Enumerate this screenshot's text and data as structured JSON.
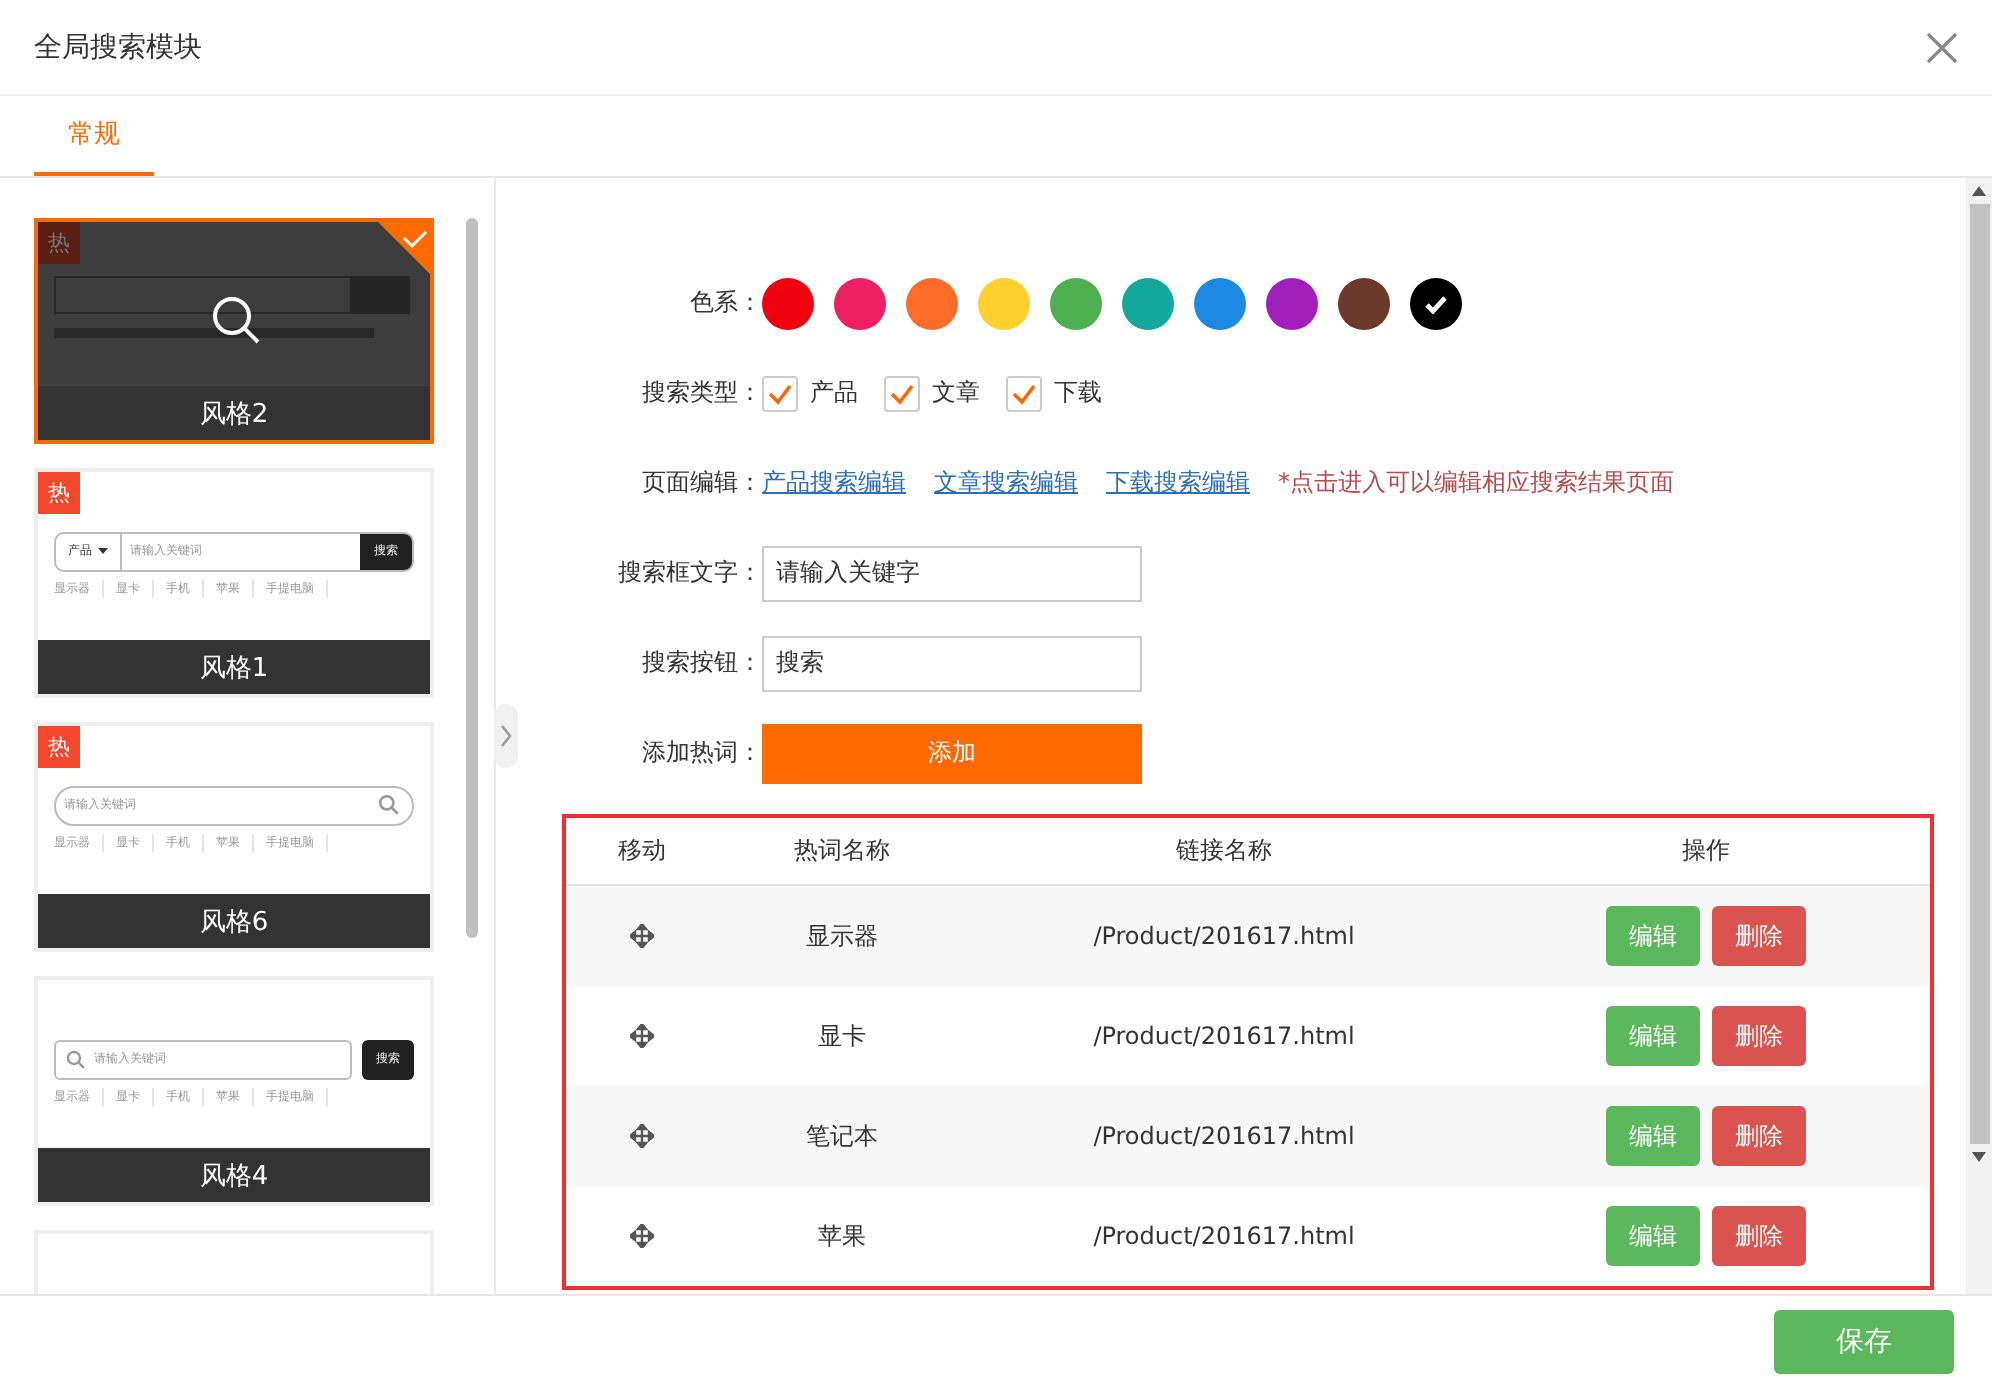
{
  "dialog": {
    "title": "全局搜索模块"
  },
  "tabs": [
    {
      "label": "常规",
      "selected": true
    }
  ],
  "styles": [
    {
      "name": "风格2",
      "kind": "icon-dropdown",
      "selected": true,
      "badge": "热"
    },
    {
      "name": "风格1",
      "kind": "dropdown-left",
      "selected": false,
      "badge": "热",
      "placeholder": "请输入关键词",
      "dropdown": "产品",
      "button": "搜索",
      "hotwords": [
        "显示器",
        "显卡",
        "手机",
        "苹果",
        "手提电脑"
      ]
    },
    {
      "name": "风格6",
      "kind": "rounded",
      "selected": false,
      "badge": "热",
      "placeholder": "请输入关键词",
      "hotwords": [
        "显示器",
        "显卡",
        "手机",
        "苹果",
        "手提电脑"
      ]
    },
    {
      "name": "风格4",
      "kind": "button-apart",
      "selected": false,
      "placeholder": "请输入关键词",
      "button": "搜索",
      "hotwords": [
        "显示器",
        "显卡",
        "手机",
        "苹果",
        "手提电脑"
      ]
    }
  ],
  "form": {
    "color_label": "色系：",
    "colors": [
      {
        "color": "#f0000f",
        "selected": false
      },
      {
        "color": "#ef1f64",
        "selected": false
      },
      {
        "color": "#ff6d28",
        "selected": false
      },
      {
        "color": "#ffd02e",
        "selected": false
      },
      {
        "color": "#4caf50",
        "selected": false
      },
      {
        "color": "#12a99a",
        "selected": false
      },
      {
        "color": "#1e88e5",
        "selected": false
      },
      {
        "color": "#a11fbb",
        "selected": false
      },
      {
        "color": "#6b3a28",
        "selected": false
      },
      {
        "color": "#000000",
        "selected": true
      }
    ],
    "type_label": "搜索类型：",
    "types": [
      {
        "label": "产品",
        "checked": true
      },
      {
        "label": "文章",
        "checked": true
      },
      {
        "label": "下载",
        "checked": true
      }
    ],
    "page_label": "页面编辑：",
    "page_links": [
      "产品搜索编辑",
      "文章搜索编辑",
      "下载搜索编辑"
    ],
    "page_note": "*点击进入可以编辑相应搜索结果页面",
    "text_label": "搜索框文字：",
    "text_value": "请输入关键字",
    "button_label": "搜索按钮：",
    "button_value": "搜索",
    "hot_label": "添加热词：",
    "add_button": "添加"
  },
  "table": {
    "columns": [
      "移动",
      "热词名称",
      "链接名称",
      "操作"
    ],
    "rows": [
      {
        "name": "显示器",
        "link": "/Product/201617.html",
        "edit": "编辑",
        "delete": "删除"
      },
      {
        "name": "显卡",
        "link": "/Product/201617.html",
        "edit": "编辑",
        "delete": "删除"
      },
      {
        "name": "笔记本",
        "link": "/Product/201617.html",
        "edit": "编辑",
        "delete": "删除"
      },
      {
        "name": "苹果",
        "link": "/Product/201617.html",
        "edit": "编辑",
        "delete": "删除"
      }
    ]
  },
  "footer": {
    "save_button": "保存"
  }
}
